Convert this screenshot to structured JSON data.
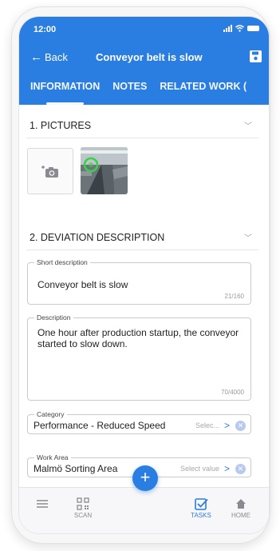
{
  "status": {
    "time": "12:00"
  },
  "nav": {
    "back_label": "Back",
    "title": "Conveyor belt is slow"
  },
  "tabs": [
    {
      "label": "INFORMATION"
    },
    {
      "label": "NOTES"
    },
    {
      "label": "RELATED WORK ("
    }
  ],
  "sections": {
    "pictures": "1. PICTURES",
    "deviation": "2. DEVIATION DESCRIPTION"
  },
  "fields": {
    "short_description": {
      "label": "Short description",
      "value": "Conveyor belt is slow",
      "counter": "21/160"
    },
    "description": {
      "label": "Description",
      "value": "One hour after production startup, the conveyor started to slow down.",
      "counter": "70/4000"
    },
    "category": {
      "label": "Category",
      "value": "Performance - Reduced Speed",
      "placeholder": "Selec..."
    },
    "work_area": {
      "label": "Work Area",
      "value": "Malmö Sorting Area",
      "placeholder": "Select value"
    }
  },
  "bottom_nav": {
    "scan": "SCAN",
    "tasks": "TASKS",
    "home": "HOME"
  },
  "colors": {
    "accent": "#2a7de1"
  }
}
